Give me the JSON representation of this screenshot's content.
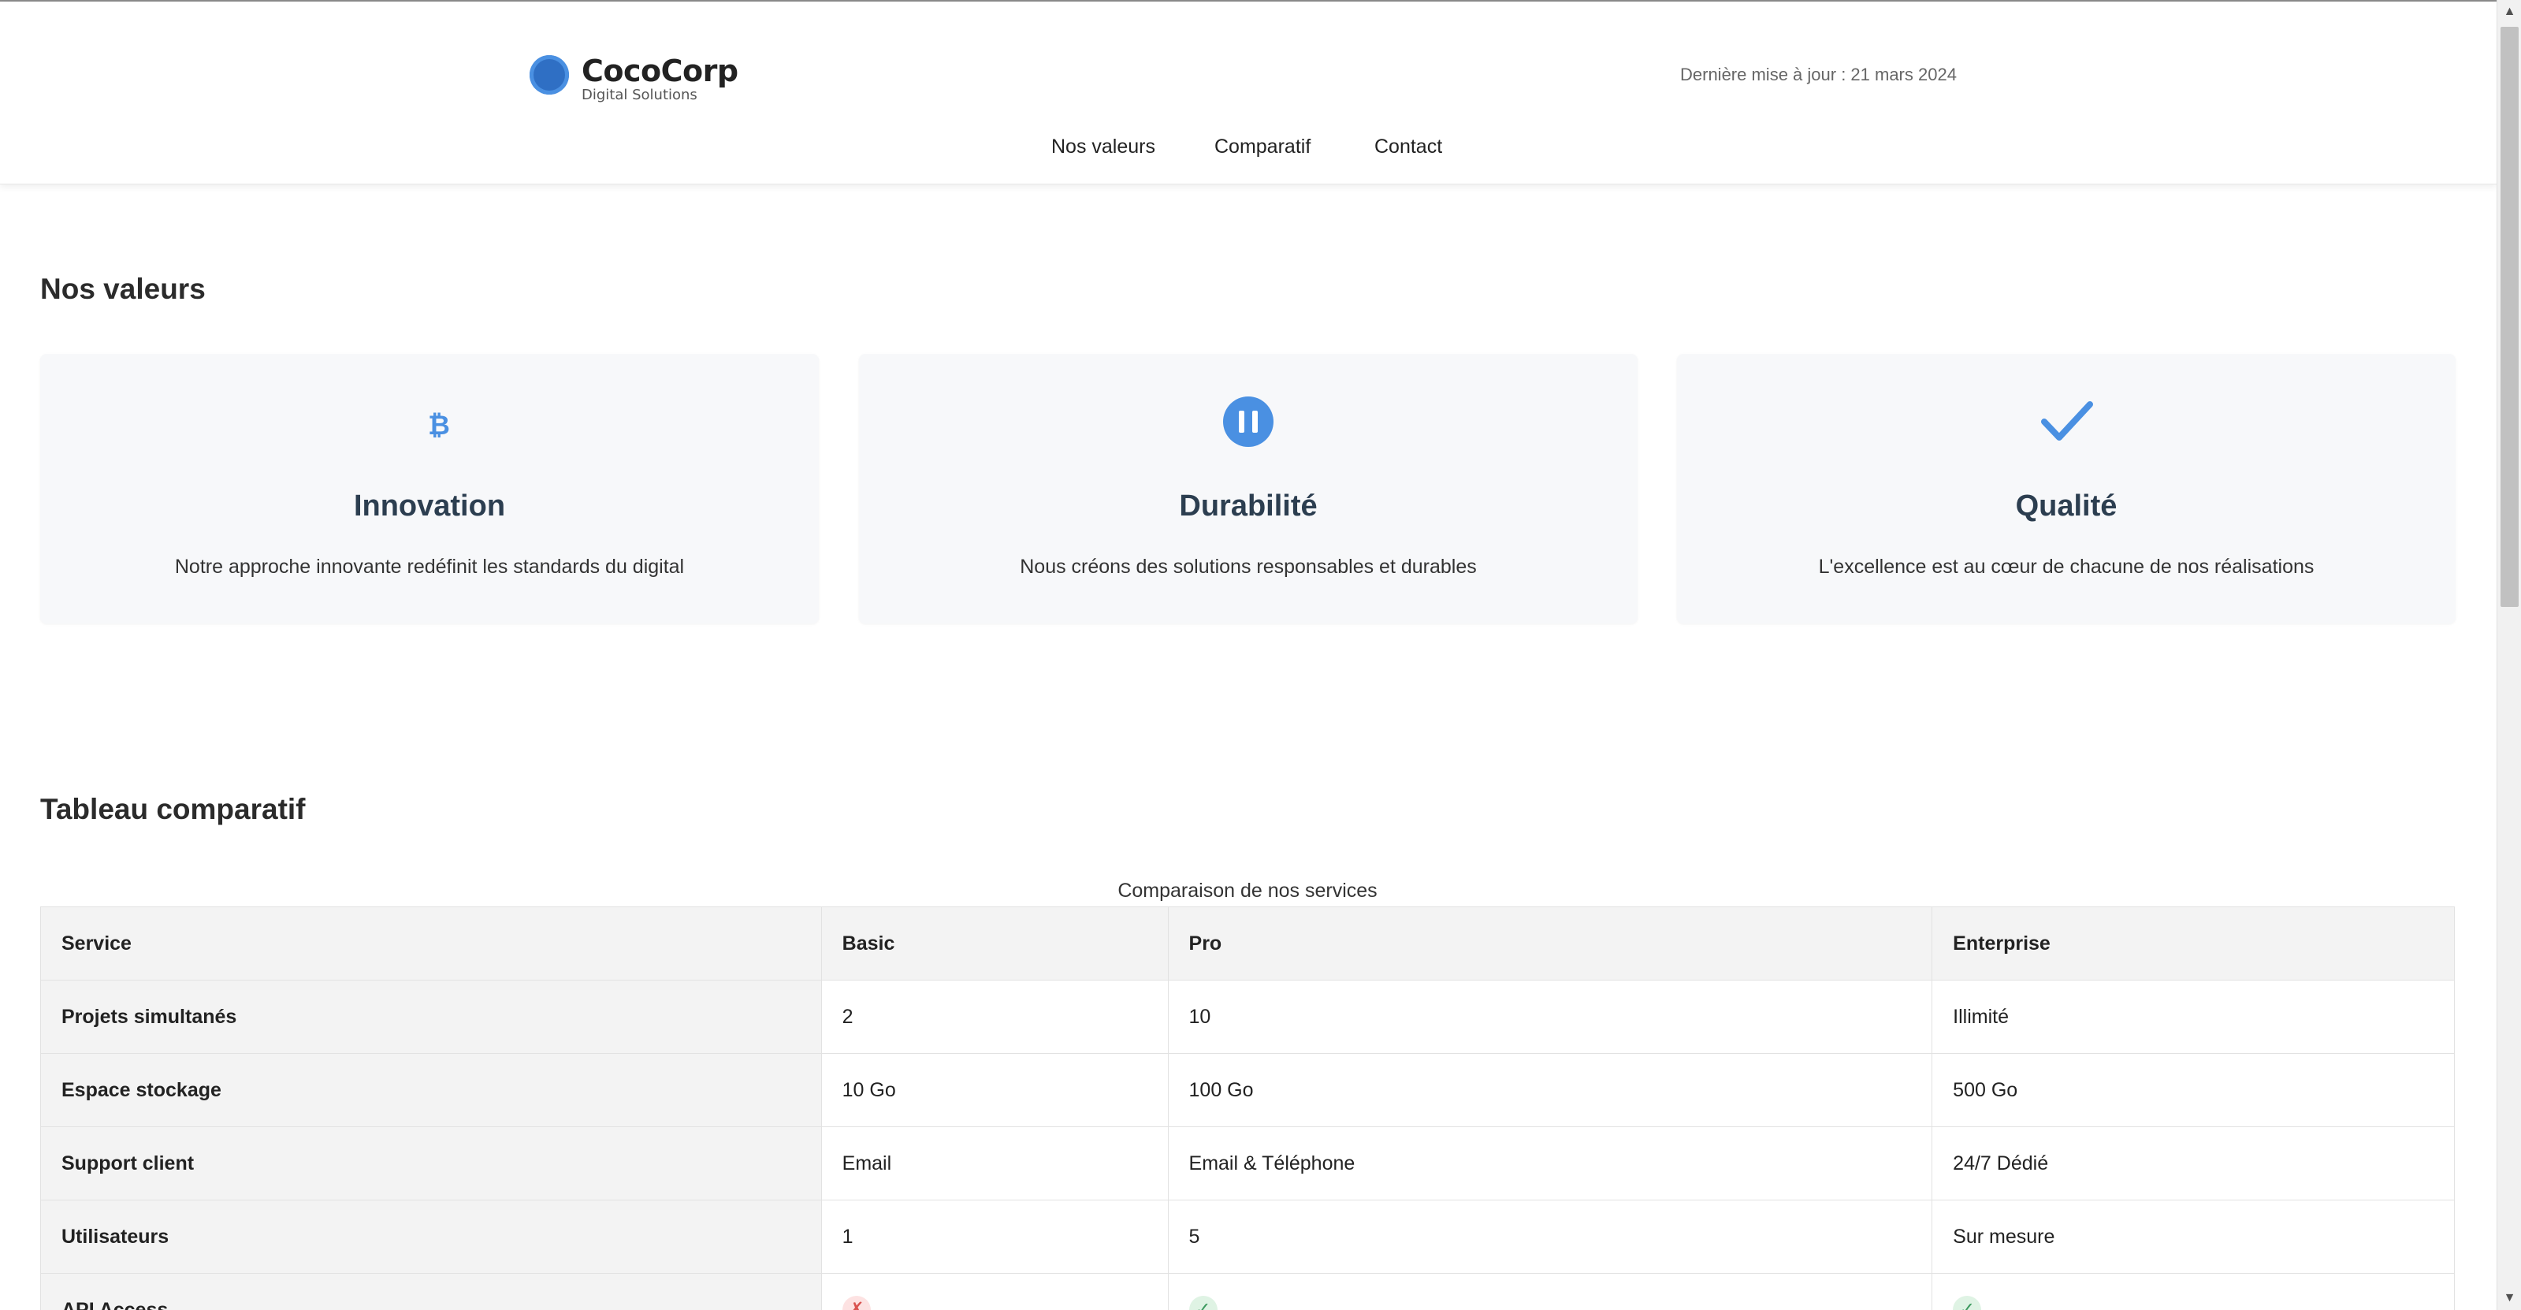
{
  "header": {
    "brand": {
      "name": "CocoCorp",
      "tagline": "Digital Solutions",
      "logo_icon": "circle-logo-icon"
    },
    "last_updated": "Dernière mise à jour : 21 mars 2024",
    "nav": [
      {
        "label": "Nos valeurs"
      },
      {
        "label": "Comparatif"
      },
      {
        "label": "Contact"
      }
    ]
  },
  "values_section": {
    "title": "Nos valeurs",
    "cards": [
      {
        "icon": "bitcoin-icon",
        "title": "Innovation",
        "text": "Notre approche innovante redéfinit les standards du digital"
      },
      {
        "icon": "pause-circle-icon",
        "title": "Durabilité",
        "text": "Nous créons des solutions responsables et durables"
      },
      {
        "icon": "checkmark-icon",
        "title": "Qualité",
        "text": "L'excellence est au cœur de chacune de nos réalisations"
      }
    ]
  },
  "comparison_section": {
    "title": "Tableau comparatif",
    "caption": "Comparaison de nos services",
    "columns": [
      "Service",
      "Basic",
      "Pro",
      "Enterprise"
    ],
    "rows": [
      {
        "label": "Projets simultanés",
        "values": [
          "2",
          "10",
          "Illimité"
        ]
      },
      {
        "label": "Espace stockage",
        "values": [
          "10 Go",
          "100 Go",
          "500 Go"
        ]
      },
      {
        "label": "Support client",
        "values": [
          "Email",
          "Email & Téléphone",
          "24/7 Dédié"
        ]
      },
      {
        "label": "Utilisateurs",
        "values": [
          "1",
          "5",
          "Sur mesure"
        ]
      },
      {
        "label": "API Access",
        "values": [
          "✗",
          "✓",
          "✓"
        ]
      }
    ]
  },
  "colors": {
    "accent": "#4a90e2",
    "card_background": "#f7f8fa",
    "heading": "#2c3e50",
    "no_mark": "#d9534f",
    "yes_mark": "#3c9a5f"
  }
}
